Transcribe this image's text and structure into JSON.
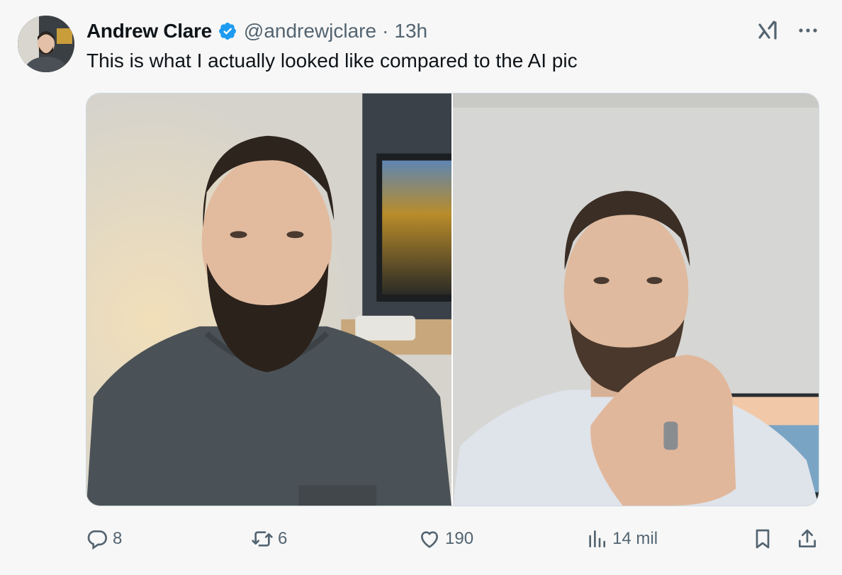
{
  "tweet": {
    "author_name": "Andrew Clare",
    "handle": "@andrewjclare",
    "separator": "·",
    "time": "13h",
    "text": "This is what I actually looked like compared to the AI pic",
    "verified_color": "#1d9bf0"
  },
  "media": {
    "count": 2
  },
  "actions": {
    "replies": "8",
    "reposts": "6",
    "likes": "190",
    "views": "14 mil"
  },
  "icons": [
    "grok-icon",
    "more-icon",
    "reply-icon",
    "repost-icon",
    "like-icon",
    "views-icon",
    "bookmark-icon",
    "share-icon"
  ],
  "colors": {
    "text": "#0f1419",
    "secondary": "#536471",
    "accent": "#1d9bf0",
    "background": "#f7f7f7"
  }
}
